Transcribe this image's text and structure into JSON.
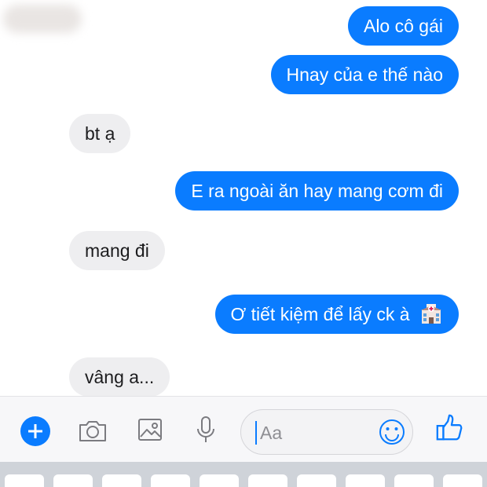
{
  "messages": [
    {
      "direction": "out",
      "text": "Alo cô gái"
    },
    {
      "direction": "out",
      "text": "Hnay của e thế nào"
    },
    {
      "direction": "in",
      "text": "bt ạ"
    },
    {
      "direction": "out",
      "text": "E ra ngoài ăn hay mang cơm đi"
    },
    {
      "direction": "in",
      "text": "mang đi"
    },
    {
      "direction": "out",
      "text": "Ơ tiết kiệm để lấy ck à",
      "emoji": "hospital-emoji"
    },
    {
      "direction": "in",
      "text": "vâng a..."
    }
  ],
  "composer": {
    "placeholder": "Aa",
    "icons": [
      "plus-icon",
      "camera-icon",
      "image-icon",
      "microphone-icon",
      "emoji-icon",
      "thumbs-up-icon"
    ]
  },
  "colors": {
    "accent": "#0a7cff",
    "incoming_bubble": "#eeeef0",
    "background": "#ffffff"
  }
}
